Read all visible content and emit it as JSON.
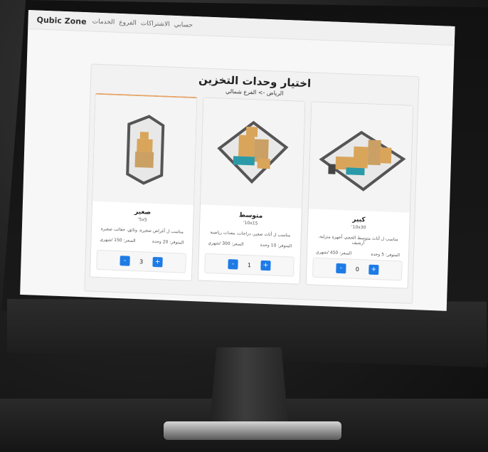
{
  "navbar": {
    "brand": "Qubic Zone",
    "links": [
      "الخدمات",
      "الفروع",
      "الاشتراكات",
      "حسابي"
    ]
  },
  "page": {
    "title": "اختيار وحدات التخزين",
    "subtitle": "الرياض -> الفرع شمالي"
  },
  "units": [
    {
      "name": "كبير",
      "dim": "10x30'",
      "desc": "مناسب ل أثاث متوسط الحجم، أجهزة منزلية، أرشيف",
      "available": "المتوفر: 5 وحدة",
      "price": "السعر: 450 /شهري",
      "qty": "0",
      "minus": "-",
      "plus": "+"
    },
    {
      "name": "متوسط",
      "dim": "10x15'",
      "desc": "مناسب ل أثاث صغير، دراجات، معدات رياضية",
      "available": "المتوفر: 10 وحدة",
      "price": "السعر: 300 /شهري",
      "qty": "1",
      "minus": "-",
      "plus": "+"
    },
    {
      "name": "صغير",
      "dim": "5x5'",
      "desc": "مناسب ل أغراض صغيرة، وثائق، حقائب صغيرة",
      "available": "المتوفر: 20 وحدة",
      "price": "السعر: 150 /شهري",
      "qty": "3",
      "minus": "-",
      "plus": "+"
    }
  ],
  "colors": {
    "accent": "#1e7be6",
    "box": "#d9a55b",
    "sofa": "#2b9aa8",
    "unit_wall": "#555555"
  }
}
